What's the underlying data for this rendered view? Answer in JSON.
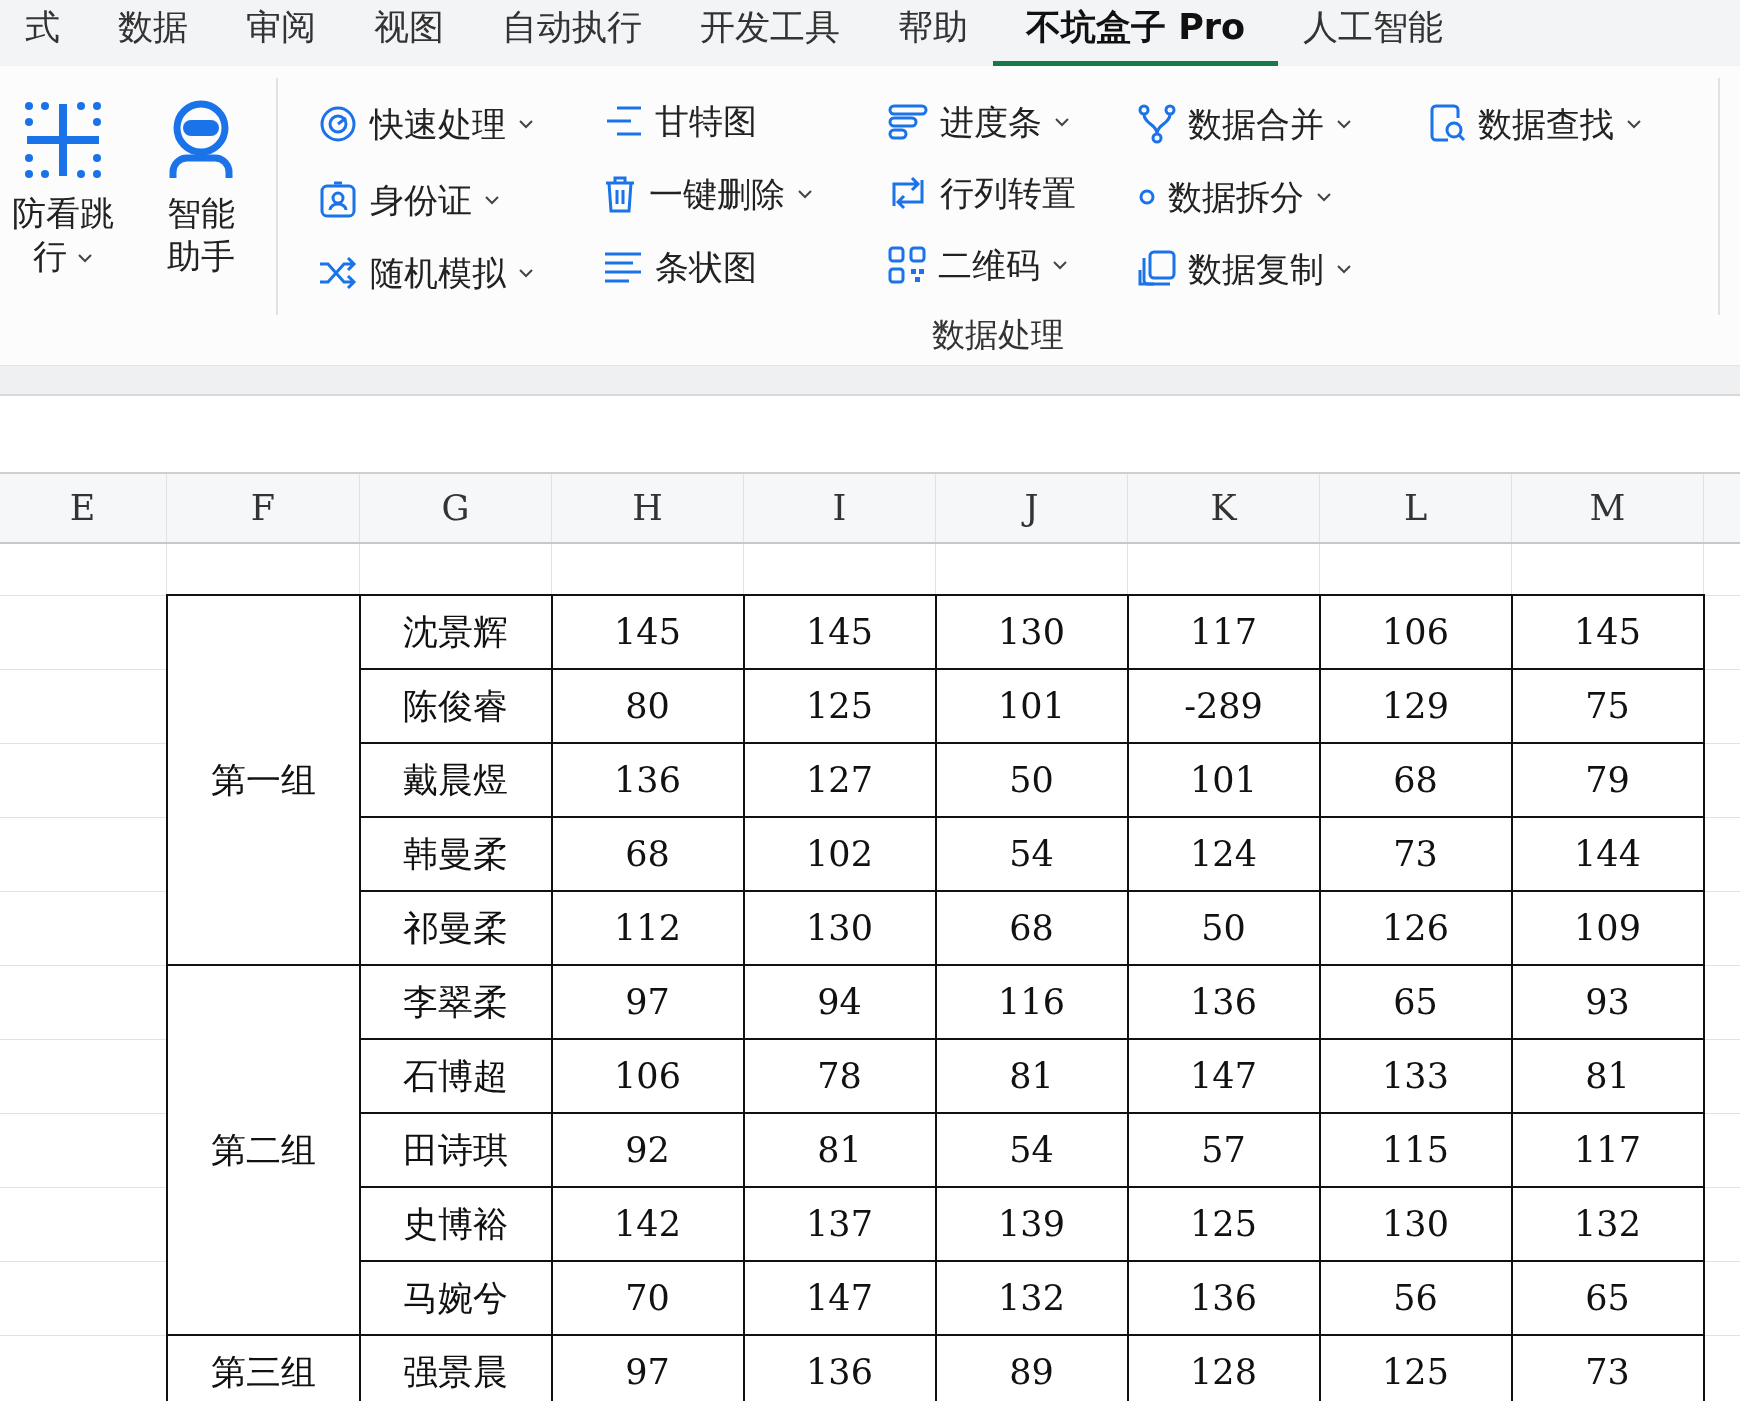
{
  "menu_tabs": [
    {
      "label": "式",
      "selected": false
    },
    {
      "label": "数据",
      "selected": false
    },
    {
      "label": "审阅",
      "selected": false
    },
    {
      "label": "视图",
      "selected": false
    },
    {
      "label": "自动执行",
      "selected": false
    },
    {
      "label": "开发工具",
      "selected": false
    },
    {
      "label": "帮助",
      "selected": false
    },
    {
      "label": "不坑盒子 Pro",
      "selected": true
    },
    {
      "label": "人工智能",
      "selected": false
    }
  ],
  "ribbon": {
    "large_buttons": [
      {
        "label": "防看跳行",
        "dropdown": true,
        "kind": "grid"
      },
      {
        "label": "智能助手",
        "dropdown": false,
        "kind": "robot"
      }
    ],
    "tool_columns": [
      [
        {
          "label": "快速处理",
          "dropdown": true,
          "kind": "gauge"
        },
        {
          "label": "身份证",
          "dropdown": true,
          "kind": "badge"
        },
        {
          "label": "随机模拟",
          "dropdown": true,
          "kind": "shuffle"
        }
      ],
      [
        {
          "label": "甘特图",
          "dropdown": false,
          "kind": "gantt"
        },
        {
          "label": "一键删除",
          "dropdown": true,
          "kind": "trash"
        },
        {
          "label": "条状图",
          "dropdown": false,
          "kind": "bars"
        }
      ],
      [
        {
          "label": "进度条",
          "dropdown": true,
          "kind": "progress"
        },
        {
          "label": "行列转置",
          "dropdown": false,
          "kind": "swap"
        },
        {
          "label": "二维码",
          "dropdown": true,
          "kind": "qr"
        }
      ],
      [
        {
          "label": "数据合并",
          "dropdown": true,
          "kind": "merge"
        },
        {
          "label": "数据拆分",
          "dropdown": true,
          "kind": "dot"
        },
        {
          "label": "数据复制",
          "dropdown": true,
          "kind": "copy"
        }
      ],
      [
        {
          "label": "数据查找",
          "dropdown": true,
          "kind": "find"
        }
      ]
    ],
    "group_label": "数据处理"
  },
  "sheet": {
    "column_headers": [
      "E",
      "F",
      "G",
      "H",
      "I",
      "J",
      "K",
      "L",
      "M"
    ],
    "groups": [
      {
        "name": "第一组",
        "rows": [
          {
            "name": "沈景辉",
            "values": [
              "145",
              "145",
              "130",
              "117",
              "106",
              "145"
            ]
          },
          {
            "name": "陈俊睿",
            "values": [
              "80",
              "125",
              "101",
              "-289",
              "129",
              "75"
            ]
          },
          {
            "name": "戴晨煜",
            "values": [
              "136",
              "127",
              "50",
              "101",
              "68",
              "79"
            ]
          },
          {
            "name": "韩曼柔",
            "values": [
              "68",
              "102",
              "54",
              "124",
              "73",
              "144"
            ]
          },
          {
            "name": "祁曼柔",
            "values": [
              "112",
              "130",
              "68",
              "50",
              "126",
              "109"
            ]
          }
        ]
      },
      {
        "name": "第二组",
        "rows": [
          {
            "name": "李翠柔",
            "values": [
              "97",
              "94",
              "116",
              "136",
              "65",
              "93"
            ]
          },
          {
            "name": "石博超",
            "values": [
              "106",
              "78",
              "81",
              "147",
              "133",
              "81"
            ]
          },
          {
            "name": "田诗琪",
            "values": [
              "92",
              "81",
              "54",
              "57",
              "115",
              "117"
            ]
          },
          {
            "name": "史博裕",
            "values": [
              "142",
              "137",
              "139",
              "125",
              "130",
              "132"
            ]
          },
          {
            "name": "马婉兮",
            "values": [
              "70",
              "147",
              "132",
              "136",
              "56",
              "65"
            ]
          }
        ]
      },
      {
        "name": "第三组",
        "rows": [
          {
            "name": "强景晨",
            "values": [
              "97",
              "136",
              "89",
              "128",
              "125",
              "73"
            ]
          }
        ]
      }
    ]
  }
}
